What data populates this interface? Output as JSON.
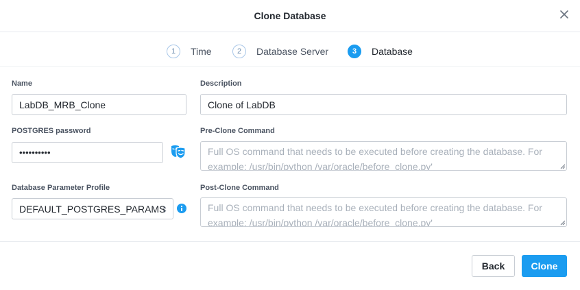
{
  "dialog": {
    "title": "Clone Database"
  },
  "steps": [
    {
      "number": "1",
      "label": "Time"
    },
    {
      "number": "2",
      "label": "Database Server"
    },
    {
      "number": "3",
      "label": "Database"
    }
  ],
  "form": {
    "name_label": "Name",
    "name_value": "LabDB_MRB_Clone",
    "description_label": "Description",
    "description_value": "Clone of LabDB",
    "password_label": "POSTGRES password",
    "password_value": "••••••••••",
    "pre_clone_label": "Pre-Clone Command",
    "pre_clone_placeholder": "Full OS command that needs to be executed before creating the database. For example: /usr/bin/python /var/oracle/before_clone.py'",
    "profile_label": "Database Parameter Profile",
    "profile_value": "DEFAULT_POSTGRES_PARAMS",
    "post_clone_label": "Post-Clone Command",
    "post_clone_placeholder": "Full OS command that needs to be executed before creating the database. For example: /usr/bin/python /var/oracle/before_clone.py'"
  },
  "footer": {
    "back_label": "Back",
    "clone_label": "Clone"
  },
  "colors": {
    "accent": "#1b9cf0",
    "border": "#c8cdd4",
    "text": "#22272e",
    "placeholder": "#a8b0ba"
  },
  "icons": {
    "close": "close-icon",
    "password_reveal": "mask-icon",
    "profile_info": "info-icon"
  }
}
